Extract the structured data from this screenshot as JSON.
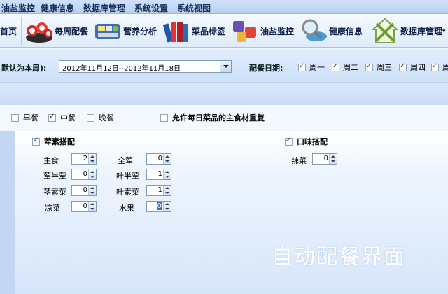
{
  "menu": [
    "油盐监控",
    "健康信息",
    "数据库管理",
    "系统设置",
    "系统视图"
  ],
  "toolbar": {
    "home": "首页",
    "items": [
      "每周配餐",
      "营养分析",
      "菜品标签",
      "油盐监控",
      "健康信息",
      "数据库管理"
    ]
  },
  "date": {
    "caption": "默认为本周):",
    "value": "2012年11月12日--2012年11月18日",
    "days_caption": "配餐日期:",
    "days": [
      {
        "label": "周一",
        "checked": true
      },
      {
        "label": "周二",
        "checked": true
      },
      {
        "label": "周三",
        "checked": true
      },
      {
        "label": "周四",
        "checked": true
      },
      {
        "label": "周",
        "checked": true
      }
    ]
  },
  "meals": [
    {
      "label": "早餐",
      "checked": false
    },
    {
      "label": "中餐",
      "checked": true
    },
    {
      "label": "晚餐",
      "checked": false
    }
  ],
  "allow_repeat": {
    "label": "允许每日菜品的主食材重复",
    "checked": false
  },
  "veg_group": {
    "label": "荤素搭配",
    "checked": true,
    "fields": [
      {
        "label": "主食",
        "value": "2"
      },
      {
        "label": "全荤",
        "value": "0"
      },
      {
        "label": "荤半荤",
        "value": "0"
      },
      {
        "label": "叶半荤",
        "value": "1"
      },
      {
        "label": "茎素菜",
        "value": "0"
      },
      {
        "label": "叶素菜",
        "value": "1"
      },
      {
        "label": "凉菜",
        "value": "0"
      },
      {
        "label": "水果",
        "value": "0"
      }
    ]
  },
  "taste_group": {
    "label": "口味搭配",
    "checked": true,
    "fields": [
      {
        "label": "辣菜",
        "value": "0"
      }
    ]
  },
  "watermark": "自动配餐界面"
}
